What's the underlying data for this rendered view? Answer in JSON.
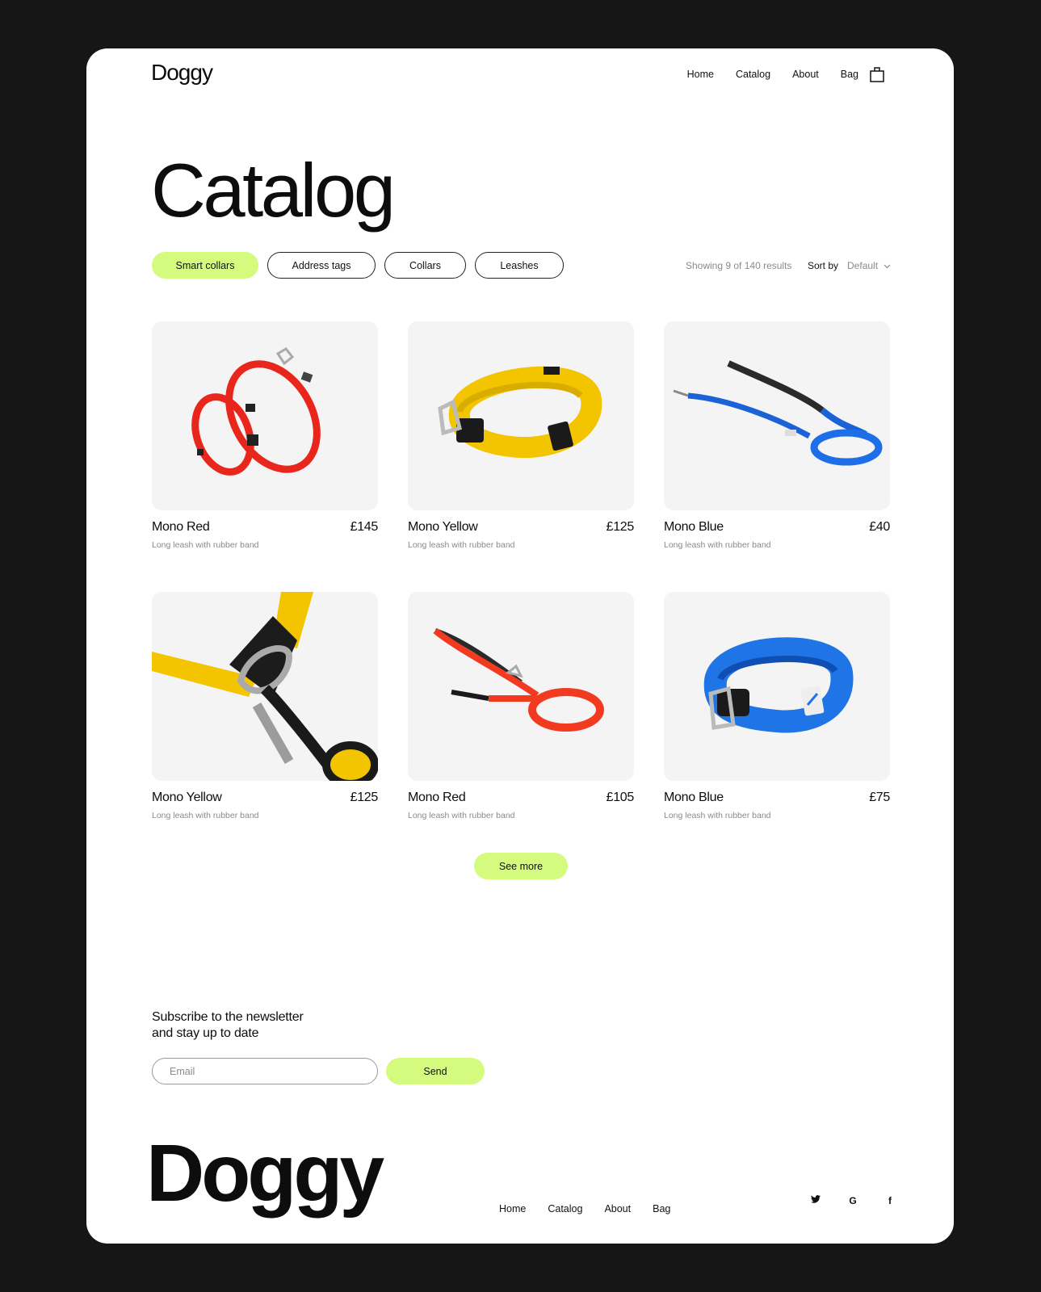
{
  "brand": {
    "name": "Doggy",
    "accent_color": "#d4fb7e"
  },
  "header": {
    "nav": [
      "Home",
      "Catalog",
      "About",
      "Bag"
    ],
    "bag_icon": "shopping-bag-icon"
  },
  "page": {
    "title": "Catalog"
  },
  "filters": [
    {
      "label": "Smart collars",
      "active": true
    },
    {
      "label": "Address tags",
      "active": false
    },
    {
      "label": "Collars",
      "active": false
    },
    {
      "label": "Leashes",
      "active": false
    }
  ],
  "results_text": "Showing 9 of 140 results",
  "sort": {
    "label": "Sort by",
    "value": "Default",
    "icon": "chevron-down-icon"
  },
  "products": [
    {
      "name": "Mono Red",
      "price": "£145",
      "description": "Long leash with rubber band",
      "image": "red-harness"
    },
    {
      "name": "Mono Yellow",
      "price": "£125",
      "description": "Long leash with rubber band",
      "image": "yellow-collar"
    },
    {
      "name": "Mono Blue",
      "price": "£40",
      "description": "Long leash with rubber band",
      "image": "blue-leash"
    },
    {
      "name": "Mono Yellow",
      "price": "£125",
      "description": "Long leash with rubber band",
      "image": "yellow-carabiner"
    },
    {
      "name": "Mono Red",
      "price": "£105",
      "description": "Long leash with rubber band",
      "image": "red-leash"
    },
    {
      "name": "Mono Blue",
      "price": "£75",
      "description": "Long leash with rubber band",
      "image": "blue-collar"
    }
  ],
  "see_more_label": "See more",
  "newsletter": {
    "line1": "Subscribe to the newsletter",
    "line2": "and stay up to date",
    "email_placeholder": "Email",
    "send_label": "Send"
  },
  "footer": {
    "logo": "Doggy",
    "nav": [
      "Home",
      "Catalog",
      "About",
      "Bag"
    ],
    "social": [
      {
        "icon": "twitter-icon",
        "glyph": "🐦"
      },
      {
        "icon": "google-icon",
        "glyph": "G"
      },
      {
        "icon": "facebook-icon",
        "glyph": "f"
      }
    ]
  }
}
